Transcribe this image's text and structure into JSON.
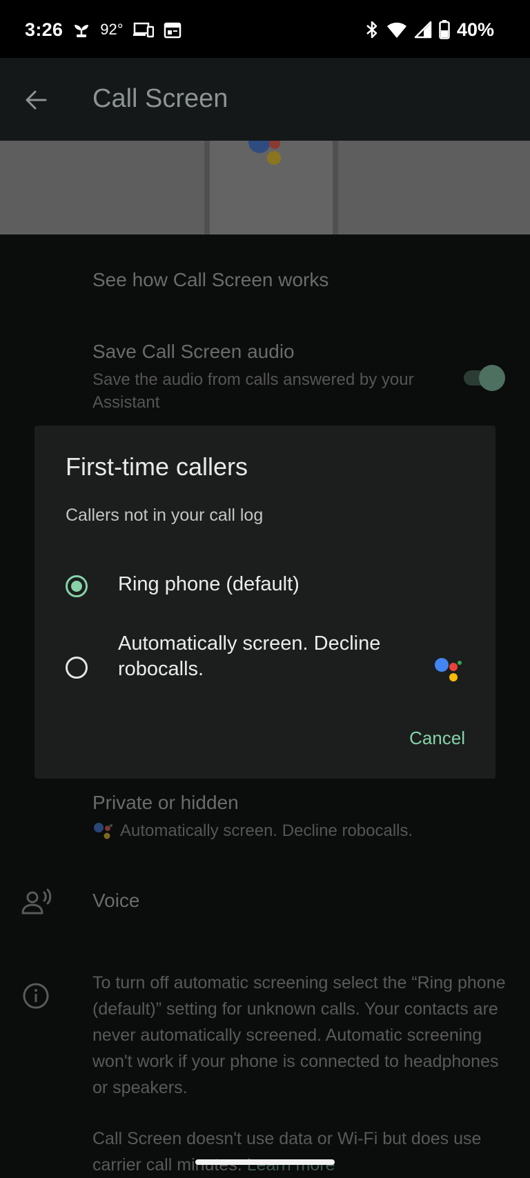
{
  "status_bar": {
    "time": "3:26",
    "temperature": "92°",
    "battery": "40%",
    "icons": [
      "sprout-icon",
      "devices-icon",
      "calendar-icon",
      "bluetooth-icon",
      "wifi-icon",
      "signal-icon",
      "battery-icon"
    ]
  },
  "app_bar": {
    "title": "Call Screen",
    "back_icon": "arrow-left-icon"
  },
  "settings": {
    "see_how": "See how Call Screen works",
    "save_audio": {
      "title": "Save Call Screen audio",
      "subtitle": "Save the audio from calls answered by your Assistant",
      "enabled": true
    },
    "private": {
      "title": "Private or hidden",
      "subtitle": "Automatically screen. Decline robocalls."
    },
    "voice": "Voice",
    "info_text": "To turn off automatic screening select the “Ring phone (default)” setting for unknown calls. Your contacts are never automatically screened. Automatic screening won't work if your phone is connected to headphones or speakers.",
    "data_text": "Call Screen doesn't use data or Wi-Fi but does use carrier call minutes.",
    "learn_more": "Learn more"
  },
  "dialog": {
    "title": "First-time callers",
    "subtitle": "Callers not in your call log",
    "options": [
      {
        "label": "Ring phone (default)",
        "selected": true
      },
      {
        "label": "Automatically screen. Decline robocalls.",
        "selected": false
      }
    ],
    "cancel": "Cancel"
  },
  "colors": {
    "accent": "#86d3a8",
    "assistant_blue": "#4285f4",
    "assistant_red": "#ea4335",
    "assistant_yellow": "#fbbc05",
    "assistant_green": "#34a853"
  }
}
